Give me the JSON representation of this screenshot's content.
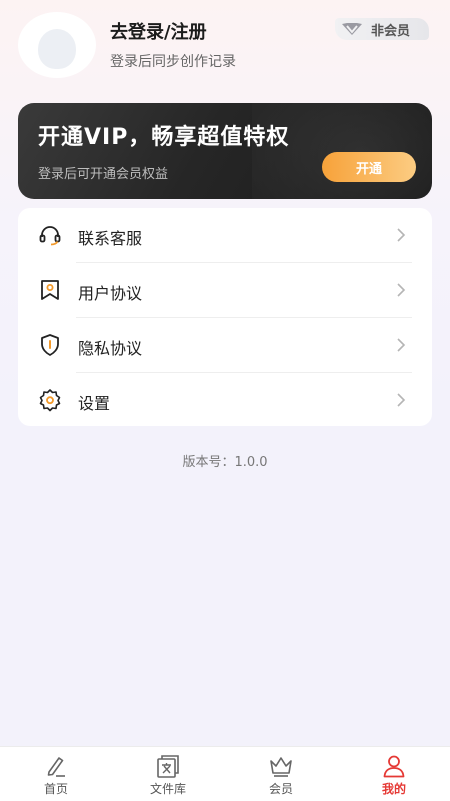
{
  "profile": {
    "login_title": "去登录/注册",
    "login_subtitle": "登录后同步创作记录",
    "member_badge": "非会员"
  },
  "vip_card": {
    "title": "开通VIP，畅享超值特权",
    "subtitle": "登录后可开通会员权益",
    "button_label": "开通"
  },
  "menu": {
    "items": [
      {
        "label": "联系客服",
        "icon": "headset-icon"
      },
      {
        "label": "用户协议",
        "icon": "bookmark-icon"
      },
      {
        "label": "隐私协议",
        "icon": "shield-icon"
      },
      {
        "label": "设置",
        "icon": "gear-icon"
      }
    ]
  },
  "version_text": "版本号：1.0.0",
  "tabbar": {
    "tabs": [
      {
        "label": "首页",
        "icon": "pen-icon"
      },
      {
        "label": "文件库",
        "icon": "document-icon"
      },
      {
        "label": "会员",
        "icon": "crown-icon"
      },
      {
        "label": "我的",
        "icon": "user-icon"
      }
    ],
    "active_index": 3
  },
  "colors": {
    "accent_orange": "#f7a23a",
    "active_tab_red": "#e53935",
    "vip_card_dark": "#262626"
  }
}
